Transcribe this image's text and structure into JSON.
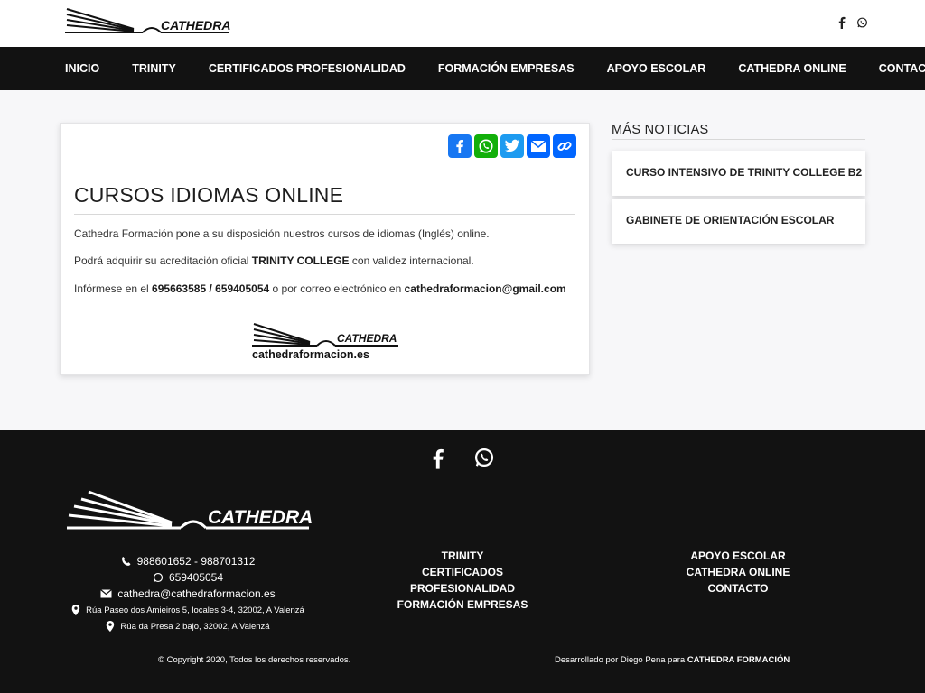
{
  "brand": {
    "logo_text": "CATHEDRA",
    "logo_subtext": "cathedraformacion.es"
  },
  "header": {
    "social": [
      {
        "icon": "facebook-icon"
      },
      {
        "icon": "whatsapp-icon"
      }
    ]
  },
  "nav": {
    "items": [
      {
        "label": "INICIO"
      },
      {
        "label": "TRINITY"
      },
      {
        "label": "CERTIFICADOS PROFESIONALIDAD"
      },
      {
        "label": "FORMACIÓN EMPRESAS"
      },
      {
        "label": "APOYO ESCOLAR"
      },
      {
        "label": "CATHEDRA ONLINE"
      },
      {
        "label": "CONTACTO"
      }
    ]
  },
  "article": {
    "share": [
      {
        "icon": "facebook-icon",
        "color": "#1877f2"
      },
      {
        "icon": "whatsapp-icon",
        "color": "#12af0a"
      },
      {
        "icon": "twitter-icon",
        "color": "#1d9bf0"
      },
      {
        "icon": "email-icon",
        "color": "#0166ff"
      },
      {
        "icon": "copy-link-icon",
        "color": "#0166ff"
      }
    ],
    "title": "CURSOS IDIOMAS ONLINE",
    "p1": "Cathedra Formación pone a su disposición nuestros cursos de idiomas (Inglés) online.",
    "p2_a": "Podrá adquirir su acreditación oficial ",
    "p2_b": "TRINITY COLLEGE",
    "p2_c": " con validez internacional.",
    "p3_a": "Infórmese en el ",
    "p3_b": "695663585 / 659405054",
    "p3_c": " o por correo electrónico en ",
    "p3_d": "cathedraformacion@gmail.com"
  },
  "sidebar": {
    "title": "MÁS NOTICIAS",
    "items": [
      {
        "label": "CURSO INTENSIVO DE TRINITY COLLEGE B2"
      },
      {
        "label": "GABINETE DE ORIENTACIÓN ESCOLAR"
      }
    ]
  },
  "footer": {
    "phones": "988601652 - 988701312",
    "whatsapp": "659405054",
    "email": "cathedra@cathedraformacion.es",
    "address1": "Rúa Paseo dos Amieiros 5, locales 3-4, 32002, A Valenzá",
    "address2": "Rúa da Presa 2 bajo, 32002, A Valenzá",
    "links_col1": [
      "TRINITY",
      "CERTIFICADOS PROFESIONALIDAD",
      "FORMACIÓN EMPRESAS"
    ],
    "links_col2": [
      "APOYO ESCOLAR",
      "CATHEDRA ONLINE",
      "CONTACTO"
    ],
    "copyright": "© Copyright 2020, Todos los derechos reservados.",
    "credit_a": "Desarrollado por Diego Pena para ",
    "credit_b": "CATHEDRA FORMACIÓN"
  }
}
